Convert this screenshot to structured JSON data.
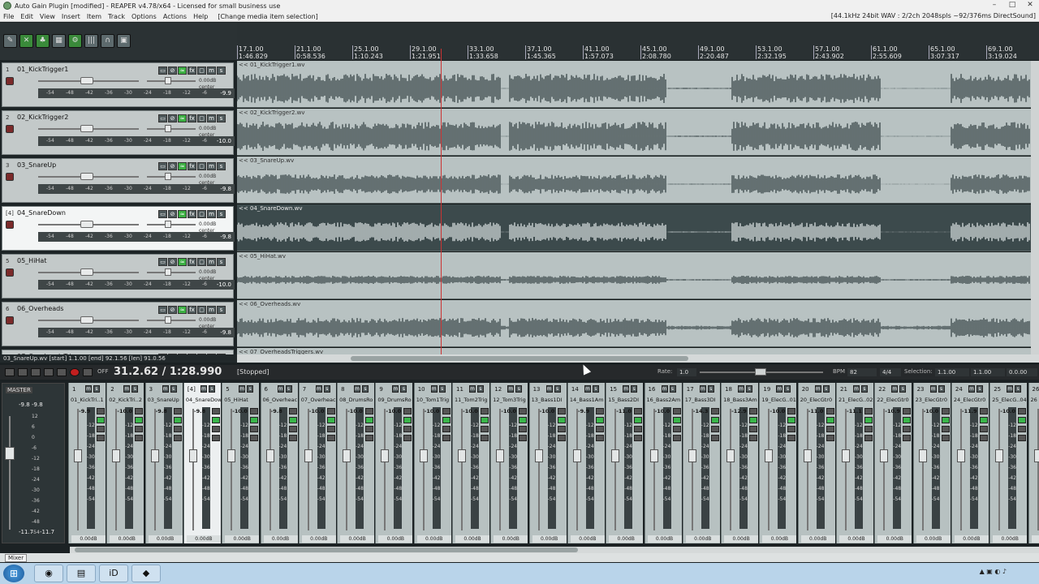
{
  "window": {
    "title": "Auto Gain Plugin [modified] - REAPER v4.78/x64 - Licensed for small business use",
    "min": "–",
    "max": "□",
    "close": "✕"
  },
  "menu": {
    "items": [
      "File",
      "Edit",
      "View",
      "Insert",
      "Item",
      "Track",
      "Options",
      "Actions",
      "Help"
    ],
    "hint": "[Change media item selection]",
    "status": "[44.1kHz 24bit WAV : 2/2ch 2048spls ~92/376ms DirectSound]"
  },
  "ruler": {
    "marks": [
      {
        "bar": "17.1.00",
        "time": "1:46.829"
      },
      {
        "bar": "21.1.00",
        "time": "0:58.536"
      },
      {
        "bar": "25.1.00",
        "time": "1:10.243"
      },
      {
        "bar": "29.1.00",
        "time": "1:21.951"
      },
      {
        "bar": "33.1.00",
        "time": "1:33.658"
      },
      {
        "bar": "37.1.00",
        "time": "1:45.365"
      },
      {
        "bar": "41.1.00",
        "time": "1:57.073"
      },
      {
        "bar": "45.1.00",
        "time": "2:08.780"
      },
      {
        "bar": "49.1.00",
        "time": "2:20.487"
      },
      {
        "bar": "53.1.00",
        "time": "2:32.195"
      },
      {
        "bar": "57.1.00",
        "time": "2:43.902"
      },
      {
        "bar": "61.1.00",
        "time": "2:55.609"
      },
      {
        "bar": "65.1.00",
        "time": "3:07.317"
      },
      {
        "bar": "69.1.00",
        "time": "3:19.024"
      }
    ]
  },
  "tracks": [
    {
      "num": "1",
      "name": "01_KickTrigger1",
      "item": "<< 01_KickTrigger1.wv",
      "vol": "-9.9",
      "selected": false
    },
    {
      "num": "2",
      "name": "02_KickTrigger2",
      "item": "<< 02_KickTrigger2.wv",
      "vol": "-10.0",
      "selected": false
    },
    {
      "num": "3",
      "name": "03_SnareUp",
      "item": "<< 03_SnareUp.wv",
      "vol": "-9.8",
      "selected": false
    },
    {
      "num": "[4]",
      "name": "04_SnareDown",
      "item": "<< 04_SnareDown.wv",
      "vol": "-9.8",
      "selected": true
    },
    {
      "num": "5",
      "name": "05_HiHat",
      "item": "<< 05_HiHat.wv",
      "vol": "-10.0",
      "selected": false
    },
    {
      "num": "6",
      "name": "06_Overheads",
      "item": "<< 06_Overheads.wv",
      "vol": "-9.8",
      "selected": false
    },
    {
      "num": "7",
      "name": "07_OverheadsTriggers",
      "item": "<< 07_OverheadsTriggers.wv",
      "vol": "",
      "selected": false
    }
  ],
  "track_common": {
    "vol_label": "0.00dB",
    "pan_label": "center",
    "scale": [
      "-54",
      "-48",
      "-42",
      "-36",
      "-30",
      "-24",
      "-18",
      "-12",
      "-6"
    ]
  },
  "status_line": "03_SnareUp.wv [start] 1.1.00 [end] 92.1.56 [len] 91.0.56",
  "transport": {
    "time": "31.2.62 / 1:28.990",
    "state": "[Stopped]",
    "off": "OFF",
    "rate_label": "Rate:",
    "rate": "1.0",
    "bpm_label": "BPM",
    "bpm": "82",
    "sig": "4/4",
    "sel_label": "Selection:",
    "sel_start": "1.1.00",
    "sel_end": "1.1.00",
    "sel_len": "0.0.00"
  },
  "master": {
    "label": "MASTER",
    "peakL": "-9.8",
    "peakR": "-9.8",
    "volL": "-11.7",
    "volR": "-11.7",
    "scale": [
      "12",
      "6",
      "0",
      "-6",
      "-12",
      "-18",
      "-24",
      "-30",
      "-36",
      "-42",
      "-48",
      "-54"
    ]
  },
  "mixer": {
    "strips": [
      {
        "num": "1",
        "name": "01_KickTri..1",
        "vol": "-9.9"
      },
      {
        "num": "2",
        "name": "02_KickTri..2",
        "vol": "-10.0"
      },
      {
        "num": "3",
        "name": "03_SnareUp",
        "vol": "-9.8"
      },
      {
        "num": "[4]",
        "name": "04_SnareDown",
        "vol": "-9.8",
        "selected": true
      },
      {
        "num": "5",
        "name": "05_HiHat",
        "vol": "-10.0"
      },
      {
        "num": "6",
        "name": "06_Overheac",
        "vol": "-9.8"
      },
      {
        "num": "7",
        "name": "07_Overheac",
        "vol": "-10.0"
      },
      {
        "num": "8",
        "name": "08_DrumsRo",
        "vol": "-10.0"
      },
      {
        "num": "9",
        "name": "09_DrumsRo",
        "vol": "-10.0"
      },
      {
        "num": "10",
        "name": "10_Tom1Trig",
        "vol": "-10.0"
      },
      {
        "num": "11",
        "name": "11_Tom2Trig",
        "vol": "-10.0"
      },
      {
        "num": "12",
        "name": "12_Tom3Trig",
        "vol": "-10.0"
      },
      {
        "num": "13",
        "name": "13_Bass1DI",
        "vol": "-10.0"
      },
      {
        "num": "14",
        "name": "14_Bass1Am",
        "vol": "-9.9"
      },
      {
        "num": "15",
        "name": "15_Bass2DI",
        "vol": "-11.0"
      },
      {
        "num": "16",
        "name": "16_Bass2Am",
        "vol": "-10.0"
      },
      {
        "num": "17",
        "name": "17_Bass3DI",
        "vol": "-14.3"
      },
      {
        "num": "18",
        "name": "18_Bass3Am",
        "vol": "-12.9"
      },
      {
        "num": "19",
        "name": "19_ElecG..01",
        "vol": "-10.0"
      },
      {
        "num": "20",
        "name": "20_ElecGtr0",
        "vol": "-11.0"
      },
      {
        "num": "21",
        "name": "21_ElecG..02",
        "vol": "-11.1"
      },
      {
        "num": "22",
        "name": "22_ElecGtr0",
        "vol": "-10.9"
      },
      {
        "num": "23",
        "name": "23_ElecGtr0",
        "vol": "-10.0"
      },
      {
        "num": "24",
        "name": "24_ElecGtr0",
        "vol": "-11.9"
      },
      {
        "num": "25",
        "name": "25_ElecG..04",
        "vol": "-10.0"
      },
      {
        "num": "26",
        "name": "26",
        "vol": ""
      }
    ],
    "center_label": "0.00dB center"
  },
  "mixer_tab": "Mixer",
  "toolbar_icons": [
    "envelope-icon",
    "x-icon",
    "leaf-icon",
    "grid-icon",
    "snap-icon",
    "split-icon",
    "headphones-icon",
    "lock-icon"
  ],
  "taskbar": {
    "apps": [
      "chrome",
      "folder",
      "iD",
      "shield"
    ],
    "start": "⊞"
  },
  "colors": {
    "selected_lane": "#3c4a4c",
    "lane": "#b8c2c2",
    "cursor": "#cc3333",
    "green_btn": "#3cb043"
  }
}
